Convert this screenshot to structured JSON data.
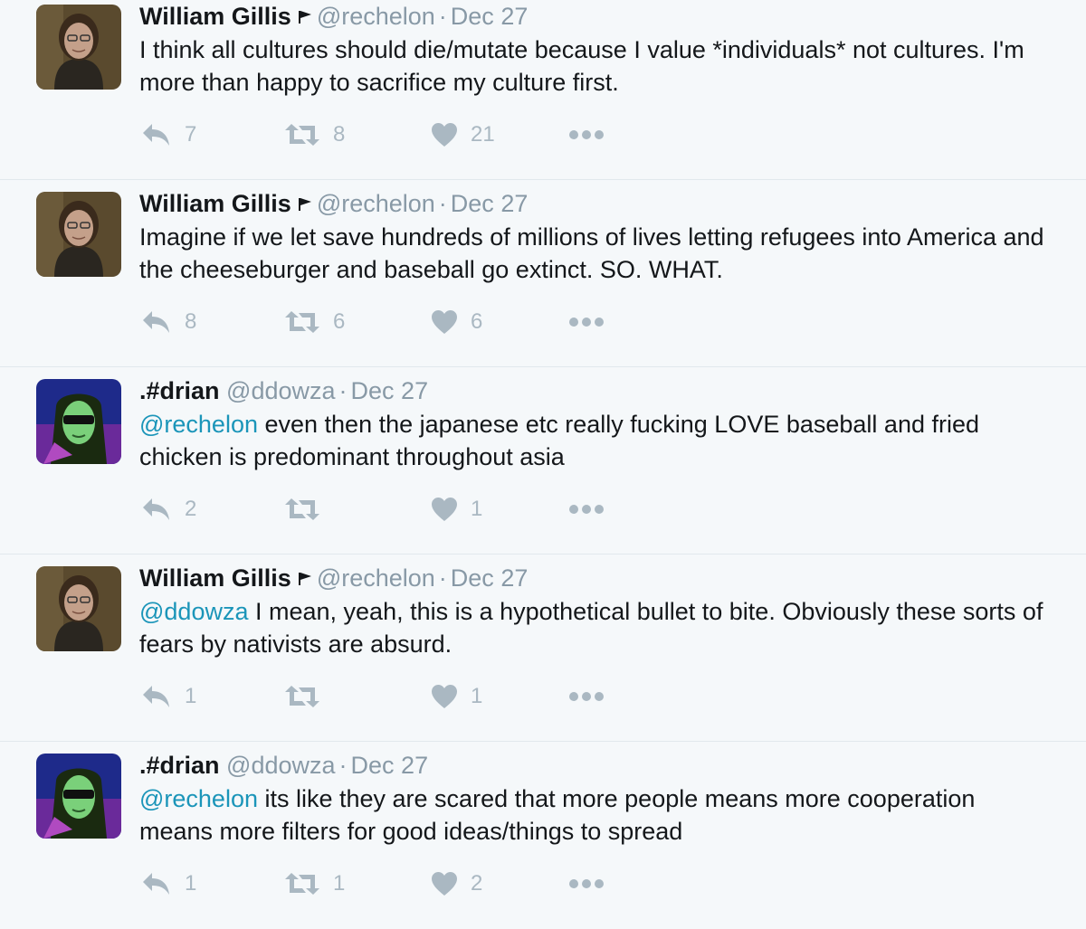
{
  "colors": {
    "background": "#f5f8fa",
    "name": "#14171a",
    "meta": "#8899a6",
    "mention": "#1b95b9",
    "icon": "#aab8c2"
  },
  "tweets": [
    {
      "name": "William Gillis",
      "has_flag": true,
      "handle": "@rechelon",
      "dot": "·",
      "time": "Dec 27",
      "mention": "",
      "text": "I think all cultures should die/mutate because I value *individuals* not cultures. I'm more than happy to sacrifice my culture first.",
      "replies": "7",
      "retweets": "8",
      "likes": "21"
    },
    {
      "name": "William Gillis",
      "has_flag": true,
      "handle": "@rechelon",
      "dot": "·",
      "time": "Dec 27",
      "mention": "",
      "text": "Imagine if we let save hundreds of millions of lives letting refugees into America and the cheeseburger and baseball go extinct. SO. WHAT.",
      "replies": "8",
      "retweets": "6",
      "likes": "6"
    },
    {
      "name": ".#drian",
      "has_flag": false,
      "handle": "@ddowza",
      "dot": "·",
      "time": "Dec 27",
      "mention": "@rechelon",
      "text": " even then the japanese etc really fucking LOVE baseball and fried chicken is predominant throughout asia",
      "replies": "2",
      "retweets": "",
      "likes": "1"
    },
    {
      "name": "William Gillis",
      "has_flag": true,
      "handle": "@rechelon",
      "dot": "·",
      "time": "Dec 27",
      "mention": "@ddowza",
      "text": " I mean, yeah, this is a hypothetical bullet to bite. Obviously these sorts of fears by nativists are absurd.",
      "replies": "1",
      "retweets": "",
      "likes": "1"
    },
    {
      "name": ".#drian",
      "has_flag": false,
      "handle": "@ddowza",
      "dot": "·",
      "time": "Dec 27",
      "mention": "@rechelon",
      "text": " its like they are scared that more people means more cooperation means more filters for good ideas/things to spread",
      "replies": "1",
      "retweets": "1",
      "likes": "2"
    }
  ]
}
